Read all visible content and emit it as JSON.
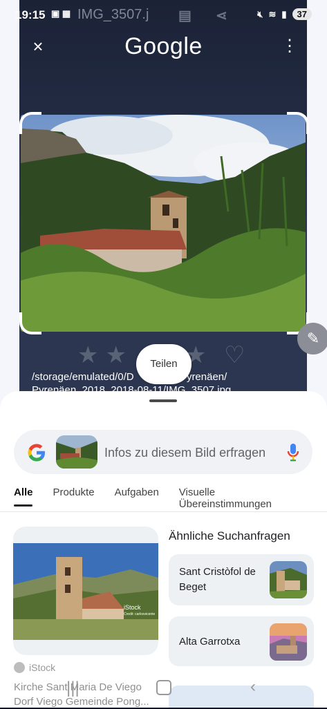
{
  "status_bar": {
    "time": "19:15",
    "filename": "IMG_3507.j",
    "battery": "37"
  },
  "header": {
    "logo": "Google",
    "close_icon": "×",
    "more_icon": "⋮"
  },
  "viewer": {
    "path": "/storage/emulated/0/D",
    "path_part2": "_Pyrenäen/",
    "path_line2": "Pyrenäen_2018_2018-08-11/IMG_3507.jpg",
    "share_label": "Teilen",
    "edit_icon": "✎"
  },
  "search": {
    "placeholder": "Infos zu diesem Bild erfragen",
    "g_letter": "G"
  },
  "tabs": [
    {
      "label": "Alle"
    },
    {
      "label": "Produkte"
    },
    {
      "label": "Aufgaben"
    },
    {
      "label": "Visuelle Übereinstimmungen"
    }
  ],
  "result": {
    "watermark": "iStock",
    "watermark_credit": "Credit: carlosvicente",
    "source": "iStock",
    "title": "Kirche Sant Maria De Viego Dorf Viego Gemeinde Pong..."
  },
  "related": {
    "heading": "Ähnliche Suchanfragen",
    "items": [
      {
        "label": "Sant Cristòfol de Beget"
      },
      {
        "label": "Alta Garrotxa"
      }
    ]
  },
  "colors": {
    "google_blue": "#4285F4",
    "google_red": "#EA4335",
    "google_yellow": "#FBBC05",
    "google_green": "#34A853"
  }
}
